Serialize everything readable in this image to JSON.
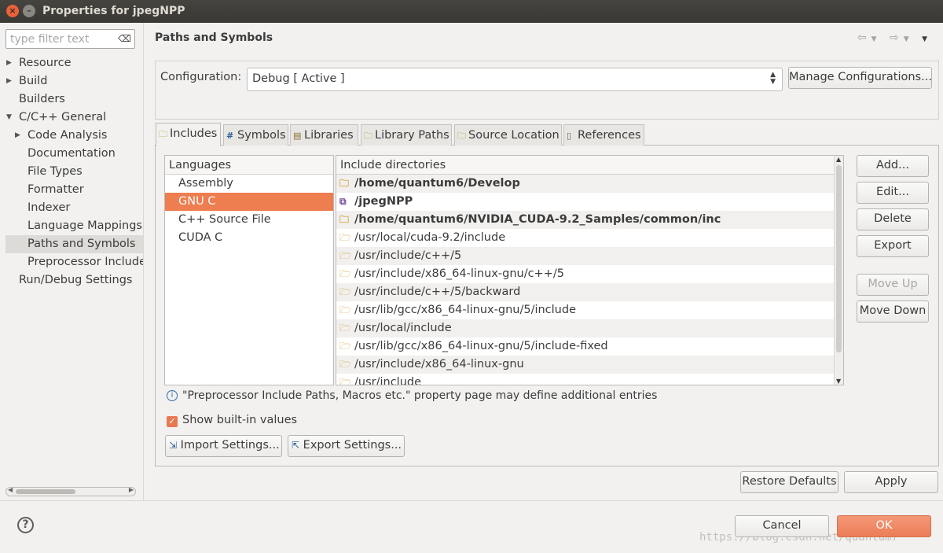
{
  "window": {
    "title": "Properties for jpegNPP"
  },
  "filter": {
    "placeholder": "type filter text"
  },
  "tree": [
    {
      "label": "Resource",
      "expandable": true
    },
    {
      "label": "Build",
      "expandable": true
    },
    {
      "label": "Builders",
      "expandable": false
    },
    {
      "label": "C/C++ General",
      "expanded": true
    },
    {
      "label": "Code Analysis",
      "expandable": true
    },
    {
      "label": "Documentation"
    },
    {
      "label": "File Types"
    },
    {
      "label": "Formatter"
    },
    {
      "label": "Indexer"
    },
    {
      "label": "Language Mappings"
    },
    {
      "label": "Paths and Symbols",
      "selected": true
    },
    {
      "label": "Preprocessor Include"
    },
    {
      "label": "Run/Debug Settings"
    }
  ],
  "page": {
    "title": "Paths and Symbols"
  },
  "config": {
    "label": "Configuration:",
    "value": "Debug  [ Active ]",
    "manage_button": "Manage Configurations..."
  },
  "tabs": [
    "Includes",
    "Symbols",
    "Libraries",
    "Library Paths",
    "Source Location",
    "References"
  ],
  "languages": {
    "header": "Languages",
    "items": [
      "Assembly",
      "GNU C",
      "C++ Source File",
      "CUDA C"
    ],
    "selected": "GNU C"
  },
  "includes": {
    "header": "Include directories",
    "rows": [
      {
        "path": "/home/quantum6/Develop",
        "bold": true,
        "icon": "workspace-folder-icon"
      },
      {
        "path": "/jpegNPP",
        "bold": true,
        "icon": "project-icon"
      },
      {
        "path": "/home/quantum6/NVIDIA_CUDA-9.2_Samples/common/inc",
        "bold": true,
        "icon": "workspace-folder-icon"
      },
      {
        "path": "/usr/local/cuda-9.2/include",
        "bold": false,
        "icon": "include-folder-icon"
      },
      {
        "path": "/usr/include/c++/5",
        "bold": false,
        "icon": "include-folder-icon"
      },
      {
        "path": "/usr/include/x86_64-linux-gnu/c++/5",
        "bold": false,
        "icon": "include-folder-icon"
      },
      {
        "path": "/usr/include/c++/5/backward",
        "bold": false,
        "icon": "include-folder-icon"
      },
      {
        "path": "/usr/lib/gcc/x86_64-linux-gnu/5/include",
        "bold": false,
        "icon": "include-folder-icon"
      },
      {
        "path": "/usr/local/include",
        "bold": false,
        "icon": "include-folder-icon"
      },
      {
        "path": "/usr/lib/gcc/x86_64-linux-gnu/5/include-fixed",
        "bold": false,
        "icon": "include-folder-icon"
      },
      {
        "path": "/usr/include/x86_64-linux-gnu",
        "bold": false,
        "icon": "include-folder-icon"
      },
      {
        "path": "/usr/include",
        "bold": false,
        "icon": "include-folder-icon"
      }
    ]
  },
  "side_buttons": {
    "add": "Add...",
    "edit": "Edit...",
    "delete": "Delete",
    "export": "Export",
    "move_up": "Move Up",
    "move_down": "Move Down"
  },
  "info_text": "\"Preprocessor Include Paths, Macros etc.\" property page may define additional entries",
  "show_builtin": {
    "label": "Show built-in values",
    "checked": true
  },
  "import_settings": "Import Settings...",
  "export_settings": "Export Settings...",
  "restore_defaults": "Restore Defaults",
  "apply": "Apply",
  "cancel": "Cancel",
  "ok": "OK",
  "watermark": "https://blog.csdn.net/quantum7",
  "colors": {
    "accent": "#ee7d4f",
    "titlebar": "#3c3b37"
  }
}
